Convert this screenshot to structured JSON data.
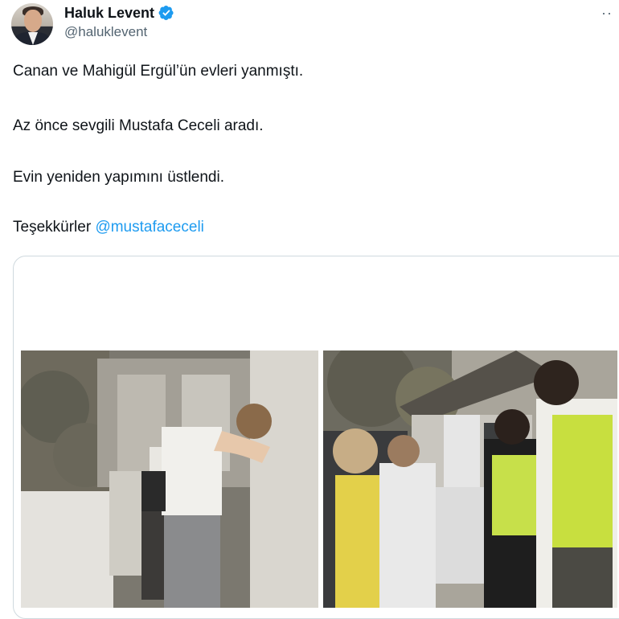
{
  "author": {
    "display_name": "Haluk Levent",
    "handle": "@haluklevent",
    "verified": true
  },
  "tweet": {
    "lines": [
      "Canan ve Mahigül Ergül’ün evleri yanmıştı.",
      "Az önce sevgili Mustafa Ceceli aradı.",
      "Evin yeniden yapımını üstlendi."
    ],
    "thanks_text": "Teşekkürler",
    "mention": "@mustafaceceli"
  },
  "icons": {
    "verified": "verified-badge-icon",
    "more": "more-options-icon"
  },
  "colors": {
    "link": "#1d9bf0",
    "verified": "#1d9bf0",
    "secondary_text": "#536471",
    "border": "#cfd9de"
  }
}
